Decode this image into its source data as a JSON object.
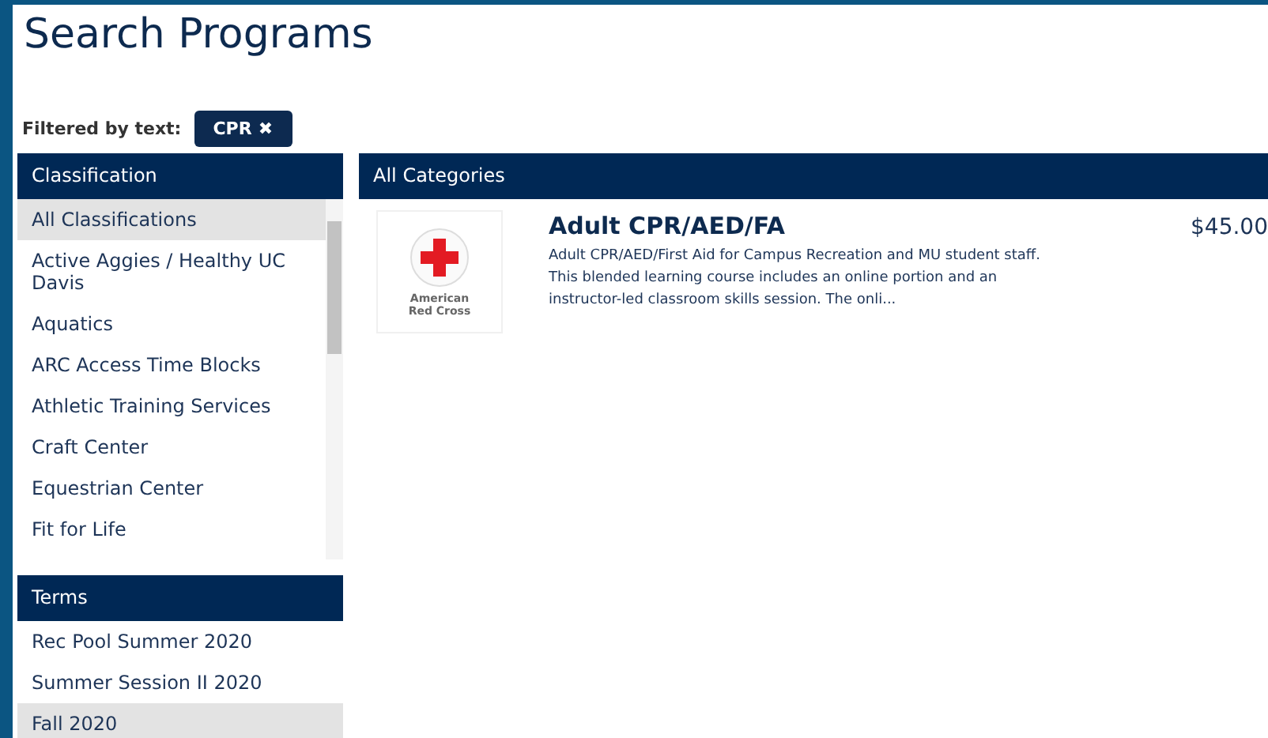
{
  "title": "Search Programs",
  "filter": {
    "label": "Filtered by text:",
    "chips": [
      {
        "text": "CPR",
        "remove_icon": "✖"
      }
    ]
  },
  "classification": {
    "header": "Classification",
    "items": [
      {
        "label": "All Classifications",
        "selected": true
      },
      {
        "label": "Active Aggies / Healthy UC Davis",
        "selected": false
      },
      {
        "label": "Aquatics",
        "selected": false
      },
      {
        "label": "ARC Access Time Blocks",
        "selected": false
      },
      {
        "label": "Athletic Training Services",
        "selected": false
      },
      {
        "label": "Craft Center",
        "selected": false
      },
      {
        "label": "Equestrian Center",
        "selected": false
      },
      {
        "label": "Fit for Life",
        "selected": false
      }
    ]
  },
  "terms": {
    "header": "Terms",
    "items": [
      {
        "label": "Rec Pool Summer 2020",
        "selected": false
      },
      {
        "label": "Summer Session II 2020",
        "selected": false
      },
      {
        "label": "Fall 2020",
        "selected": true
      }
    ]
  },
  "results": {
    "header": "All Categories",
    "programs": [
      {
        "logo_text": "American Red Cross",
        "title": "Adult CPR/AED/FA",
        "description": "Adult CPR/AED/First Aid for Campus Recreation and MU student staff. This blended learning course includes an online portion and an instructor-led classroom skills session. The onli...",
        "price": "$45.00"
      }
    ]
  }
}
